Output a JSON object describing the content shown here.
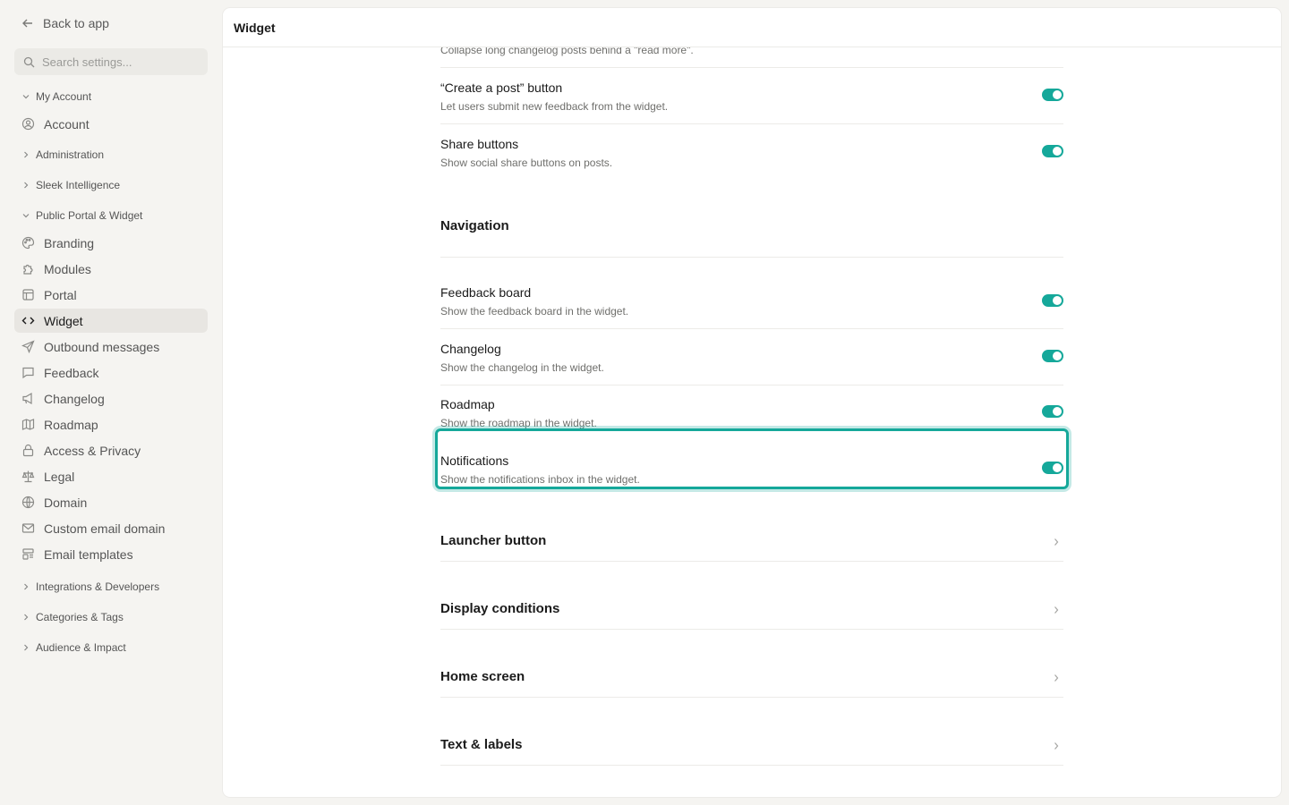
{
  "sidebar": {
    "back_label": "Back to app",
    "search_placeholder": "Search settings...",
    "groups": {
      "my_account": "My Account",
      "administration": "Administration",
      "sleek_intelligence": "Sleek Intelligence",
      "public_portal": "Public Portal & Widget",
      "integrations": "Integrations & Developers",
      "categories": "Categories & Tags",
      "audience": "Audience & Impact"
    },
    "items": {
      "account": "Account",
      "branding": "Branding",
      "modules": "Modules",
      "portal": "Portal",
      "widget": "Widget",
      "outbound": "Outbound messages",
      "feedback": "Feedback",
      "changelog": "Changelog",
      "roadmap": "Roadmap",
      "access": "Access & Privacy",
      "legal": "Legal",
      "domain": "Domain",
      "custom_email": "Custom email domain",
      "email_templates": "Email templates"
    }
  },
  "header": {
    "title": "Widget"
  },
  "content": {
    "truncated_desc": "Collapse long changelog posts behind a \"read more\".",
    "create_post": {
      "title": "“Create a post” button",
      "desc": "Let users submit new feedback from the widget."
    },
    "share": {
      "title": "Share buttons",
      "desc": "Show social share buttons on posts."
    },
    "navigation_title": "Navigation",
    "feedback_board": {
      "title": "Feedback board",
      "desc": "Show the feedback board in the widget."
    },
    "changelog": {
      "title": "Changelog",
      "desc": "Show the changelog in the widget."
    },
    "roadmap": {
      "title": "Roadmap",
      "desc": "Show the roadmap in the widget."
    },
    "notifications": {
      "title": "Notifications",
      "desc": "Show the notifications inbox in the widget."
    },
    "sections": {
      "launcher": "Launcher button",
      "display": "Display conditions",
      "home": "Home screen",
      "text": "Text & labels"
    }
  },
  "colors": {
    "accent": "#15a89a",
    "sidebar_bg": "#f5f4f1"
  },
  "toggles": {
    "create_post": true,
    "share": true,
    "feedback_board": true,
    "changelog": true,
    "roadmap": true,
    "notifications": true
  }
}
